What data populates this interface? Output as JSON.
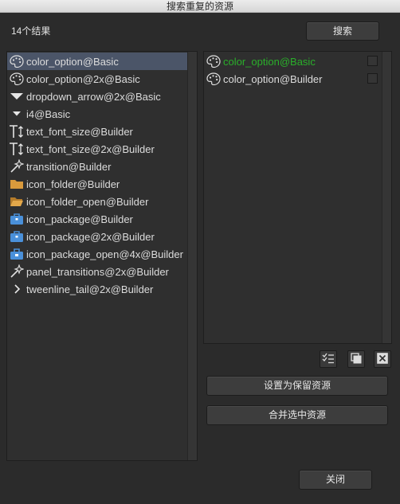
{
  "window": {
    "title": "搜索重复的资源"
  },
  "header": {
    "result_count": "14个结果",
    "search_button": "搜索"
  },
  "assets": [
    {
      "label": "color_option@Basic",
      "icon": "palette-icon",
      "selected": true
    },
    {
      "label": "color_option@2x@Basic",
      "icon": "palette-icon"
    },
    {
      "label": "dropdown_arrow@2x@Basic",
      "icon": "triangle-down-icon"
    },
    {
      "label": "i4@Basic",
      "icon": "small-triangle-down-icon"
    },
    {
      "label": "text_font_size@Builder",
      "icon": "text-size-icon"
    },
    {
      "label": "text_font_size@2x@Builder",
      "icon": "text-size-icon"
    },
    {
      "label": "transition@Builder",
      "icon": "magic-wand-icon"
    },
    {
      "label": "icon_folder@Builder",
      "icon": "folder-icon"
    },
    {
      "label": "icon_folder_open@Builder",
      "icon": "folder-open-icon"
    },
    {
      "label": "icon_package@Builder",
      "icon": "package-icon"
    },
    {
      "label": "icon_package@2x@Builder",
      "icon": "package-icon"
    },
    {
      "label": "icon_package_open@4x@Builder",
      "icon": "package-open-icon"
    },
    {
      "label": "panel_transitions@2x@Builder",
      "icon": "magic-wand-icon"
    },
    {
      "label": "tweenline_tail@2x@Builder",
      "icon": "chevron-right-icon"
    }
  ],
  "duplicates": [
    {
      "label": "color_option@Basic",
      "icon": "palette-icon",
      "primary": true,
      "checked": false
    },
    {
      "label": "color_option@Builder",
      "icon": "palette-icon",
      "primary": false,
      "checked": false
    }
  ],
  "toolbar": {
    "icons": [
      "checklist-icon",
      "copy-icon",
      "close-box-icon"
    ]
  },
  "actions": {
    "keep_button": "设置为保留资源",
    "merge_button": "合并选中资源",
    "close_button": "关闭"
  },
  "colors": {
    "selection": "#4b5568",
    "primary_text": "#2aaf2a",
    "background": "#2b2b2b"
  }
}
